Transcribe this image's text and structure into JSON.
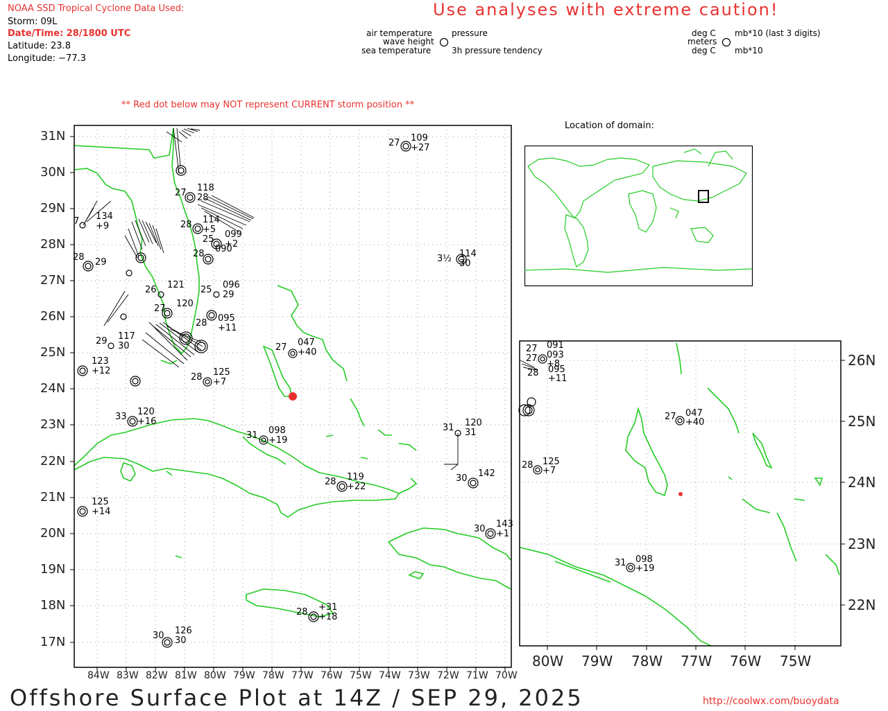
{
  "header": {
    "title": "NOAA SSD Tropical Cyclone Data Used:",
    "storm": "Storm: 09L",
    "datetime": "Date/Time: 28/1800 UTC",
    "latitude": "Latitude: 23.8",
    "longitude": "Longitude: −77.3",
    "caution": "Use analyses with extreme caution!",
    "warning": "** Red dot below may NOT represent CURRENT storm position **"
  },
  "legend": {
    "left": {
      "air_temperature": "air temperature",
      "wave_height": "wave height",
      "sea_temperature": "sea temperature",
      "pressure": "pressure",
      "tendency": "3h pressure tendency"
    },
    "right": {
      "deg_c_top": "deg C",
      "meters": "meters",
      "deg_c_bottom": "deg C",
      "mb_last3": "mb*10 (last 3 digits)",
      "mb10": "mb*10"
    }
  },
  "main_map": {
    "lat_labels": [
      "31N",
      "30N",
      "29N",
      "28N",
      "27N",
      "26N",
      "25N",
      "24N",
      "23N",
      "22N",
      "21N",
      "20N",
      "19N",
      "18N",
      "17N"
    ],
    "lon_labels": [
      "84W",
      "83W",
      "82W",
      "81W",
      "80W",
      "79W",
      "78W",
      "77W",
      "76W",
      "75W",
      "74W",
      "73W",
      "72W",
      "71W",
      "70W"
    ],
    "stations": [
      {
        "t": "27",
        "p": "109",
        "d": "+27"
      },
      {
        "t": "3½",
        "p": "114",
        "d": "30"
      },
      {
        "t": "27",
        "p": "047",
        "d": "+40"
      },
      {
        "t": "28",
        "p": "125",
        "d": "+7"
      },
      {
        "t": "33",
        "p": "120",
        "d": "+16"
      },
      {
        "t": "31",
        "p": "098",
        "d": "+19"
      },
      {
        "t": "31",
        "p": "120",
        "d": "31"
      },
      {
        "t": "28",
        "p": "119",
        "d": "+22"
      },
      {
        "t": "30",
        "p": "142",
        "d": ""
      },
      {
        "t": "30",
        "p": "143",
        "d": "+1"
      },
      {
        "t": "",
        "p": "125",
        "d": "+14"
      },
      {
        "t": "28",
        "p": "+31",
        "d": "+18"
      },
      {
        "t": "30",
        "p": "126",
        "d": "30"
      },
      {
        "t": "",
        "p": "123",
        "d": "+12"
      },
      {
        "t": "29",
        "p": "117",
        "d": "30"
      },
      {
        "t": "25",
        "p": "096",
        "d": "29"
      },
      {
        "t": "26",
        "p": "121",
        "d": ""
      },
      {
        "t": "27",
        "p": "120",
        "d": ""
      },
      {
        "t": "28",
        "p": "090",
        "d": ""
      },
      {
        "t": "25",
        "p": "099",
        "d": "+2"
      },
      {
        "t": "27",
        "p": "118",
        "d": "28"
      },
      {
        "t": "7",
        "p": "134",
        "d": "+9"
      },
      {
        "t": "28",
        "p": "095",
        "d": "+11"
      },
      {
        "t": "28",
        "p": "114",
        "d": "+5"
      },
      {
        "t": "28",
        "p": "",
        "d": "29"
      }
    ]
  },
  "locator": {
    "title": "Location of domain:"
  },
  "inset_map": {
    "lat_labels": [
      "26N",
      "25N",
      "24N",
      "23N",
      "22N"
    ],
    "lon_labels": [
      "80W",
      "79W",
      "78W",
      "77W",
      "76W",
      "75W"
    ],
    "stations": [
      {
        "t": "27",
        "p": "091",
        "d": ""
      },
      {
        "t": "27",
        "p": "093",
        "d": "+8"
      },
      {
        "t": "28",
        "p": "095",
        "d": "+11"
      },
      {
        "t": "27",
        "p": "047",
        "d": "+40"
      },
      {
        "t": "28",
        "p": "125",
        "d": "+7"
      },
      {
        "t": "31",
        "p": "098",
        "d": "+19"
      }
    ]
  },
  "footer": {
    "title": "Offshore Surface Plot at 14Z / SEP 29, 2025",
    "url": "http://coolwx.com/buoydata"
  },
  "colors": {
    "land": "#22cc22",
    "storm": "#e8322f",
    "grid": "#888888",
    "red_text": "#e8322f"
  }
}
